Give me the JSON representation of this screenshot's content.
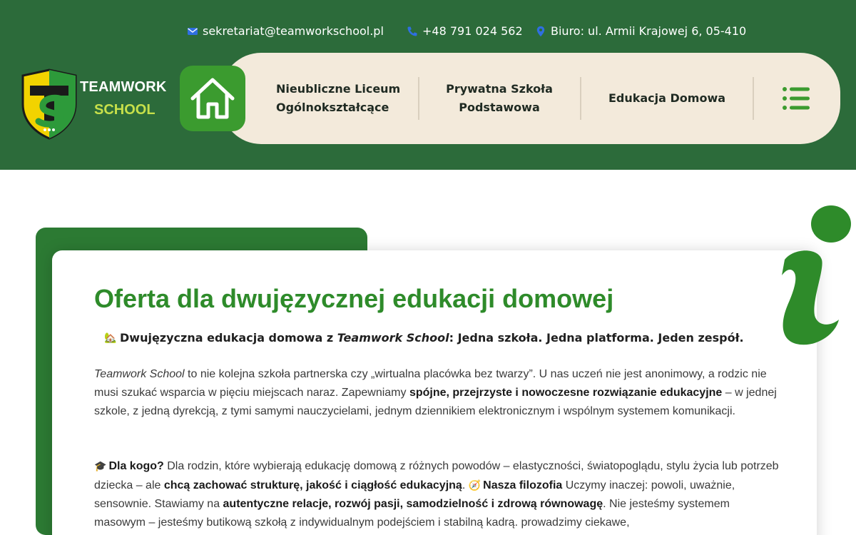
{
  "contact": {
    "email": "sekretariat@teamworkschool.pl",
    "phone": "+48 791 024 562",
    "address": "Biuro: ul. Armii Krajowej 6, 05-410"
  },
  "logo": {
    "line1": "TEAMWORK",
    "line2": "SCHOOL"
  },
  "nav": {
    "items": [
      {
        "line1": "Nieubliczne Liceum",
        "line2": "Ogólnokształcące"
      },
      {
        "line1": "Prywatna Szkoła",
        "line2": "Podstawowa"
      },
      {
        "line1": "Edukacja Domowa",
        "line2": ""
      }
    ]
  },
  "content": {
    "title": "Oferta dla dwujęzycznej edukacji domowej",
    "lead": {
      "emoji": "🏡",
      "part1": "Dwujęzyczna edukacja domowa z ",
      "brand": "Teamwork School",
      "part2": ": Jedna szkoła. Jedna platforma. Jeden zespół."
    },
    "p1": {
      "brand": "Teamwork School",
      "t1": " to nie kolejna szkoła partnerska czy „wirtualna placówka bez twarzy”. U nas uczeń nie jest anonimowy, a rodzic nie musi szukać wsparcia w pięciu miejscach naraz. Zapewniamy ",
      "b1": "spójne, przejrzyste i nowoczesne rozwiązanie edukacyjne",
      "t2": " – w jednej szkole, z jedną dyrekcją, z tymi samymi nauczycielami, jednym dziennikiem elektronicznym i wspólnym systemem komunikacji."
    },
    "p2": {
      "emoji1": "🎓",
      "b1": "Dla kogo?",
      "t1": " Dla rodzin, które wybierają edukację domową z różnych powodów – elastyczności, światopoglądu, stylu życia lub potrzeb dziecka – ale ",
      "b2": "chcą zachować strukturę, jakość i ciągłość edukacyjną",
      "t2": ". ",
      "emoji2": "🧭",
      "b3": "Nasza filozofia",
      "t3": " Uczymy inaczej: powoli, uważnie, sensownie. Stawiamy na ",
      "b4": "autentyczne relacje, rozwój pasji, samodzielność i zdrową równowagę",
      "t4": ". Nie jesteśmy systemem masowym – jesteśmy butikową szkołą z indywidualnym podejściem i stabilną kadrą. prowadzimy ciekawe,"
    }
  },
  "colors": {
    "header_bg": "#2c6b3a",
    "nav_pill": "#f3eadb",
    "accent_green": "#3b9b2f",
    "title_green": "#2e8b2a",
    "logo_yellow": "#c7e04a"
  }
}
